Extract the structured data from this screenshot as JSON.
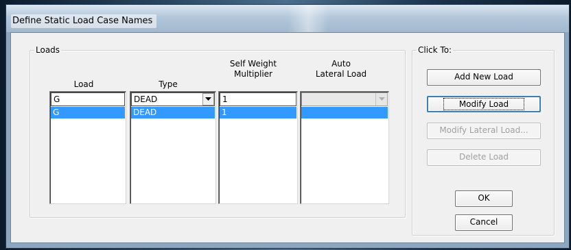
{
  "window": {
    "title": "Define Static Load Case Names"
  },
  "loads_group": {
    "legend": "Loads",
    "columns": {
      "load": "Load",
      "type": "Type",
      "self_weight_line1": "Self Weight",
      "self_weight_line2": "Multiplier",
      "auto_line1": "Auto",
      "auto_line2": "Lateral Load"
    },
    "edit_row": {
      "load": "G",
      "type": "DEAD",
      "self_weight": "1",
      "auto_lateral": ""
    },
    "rows": [
      {
        "load": "G",
        "type": "DEAD",
        "self_weight": "1",
        "auto_lateral": ""
      }
    ]
  },
  "click_group": {
    "legend": "Click To:",
    "add_new_load": "Add New Load",
    "modify_load": "Modify Load",
    "modify_lateral_load": "Modify Lateral Load...",
    "delete_load": "Delete Load"
  },
  "buttons": {
    "ok": "OK",
    "cancel": "Cancel"
  },
  "icons": {
    "dropdown": "chevron-down-icon"
  },
  "colors": {
    "selection": "#3399ff",
    "title_bar": "#b3c7db",
    "dialog_bg": "#f0f0f0"
  }
}
